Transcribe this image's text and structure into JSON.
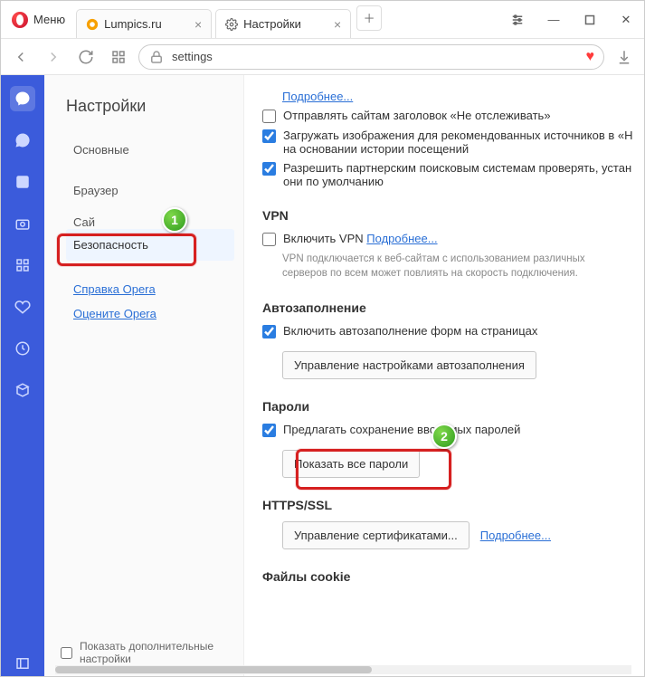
{
  "window": {
    "menu_label": "Меню",
    "tabs": [
      {
        "title": "Lumpics.ru"
      },
      {
        "title": "Настройки"
      }
    ]
  },
  "addressbar": {
    "value": "settings"
  },
  "settings": {
    "title": "Настройки",
    "nav": {
      "basic": "Основные",
      "browser": "Браузер",
      "sites_trunc": "Сай",
      "security": "Безопасность",
      "help": "Справка Opera",
      "rate": "Оцените Opera"
    },
    "footer_checkbox": "Показать дополнительные настройки"
  },
  "privacy": {
    "more": "Подробнее...",
    "opt1": "Отправлять сайтам заголовок «Не отслеживать»",
    "opt2": "Загружать изображения для рекомендованных источников в «Н на основании истории посещений",
    "opt3": "Разрешить партнерским поисковым системам проверять, устан они по умолчанию"
  },
  "vpn": {
    "heading": "VPN",
    "enable": "Включить VPN",
    "more": "Подробнее...",
    "note": "VPN подключается к веб-сайтам с использованием различных серверов по всем может повлиять на скорость подключения."
  },
  "autofill": {
    "heading": "Автозаполнение",
    "enable": "Включить автозаполнение форм на страницах",
    "manage": "Управление настройками автозаполнения"
  },
  "passwords": {
    "heading": "Пароли",
    "offer": "Предлагать сохранение вводимых паролей",
    "show_all": "Показать все пароли"
  },
  "https": {
    "heading": "HTTPS/SSL",
    "manage": "Управление сертификатами...",
    "more": "Подробнее..."
  },
  "cookies": {
    "heading": "Файлы cookie"
  },
  "badges": {
    "one": "1",
    "two": "2"
  }
}
